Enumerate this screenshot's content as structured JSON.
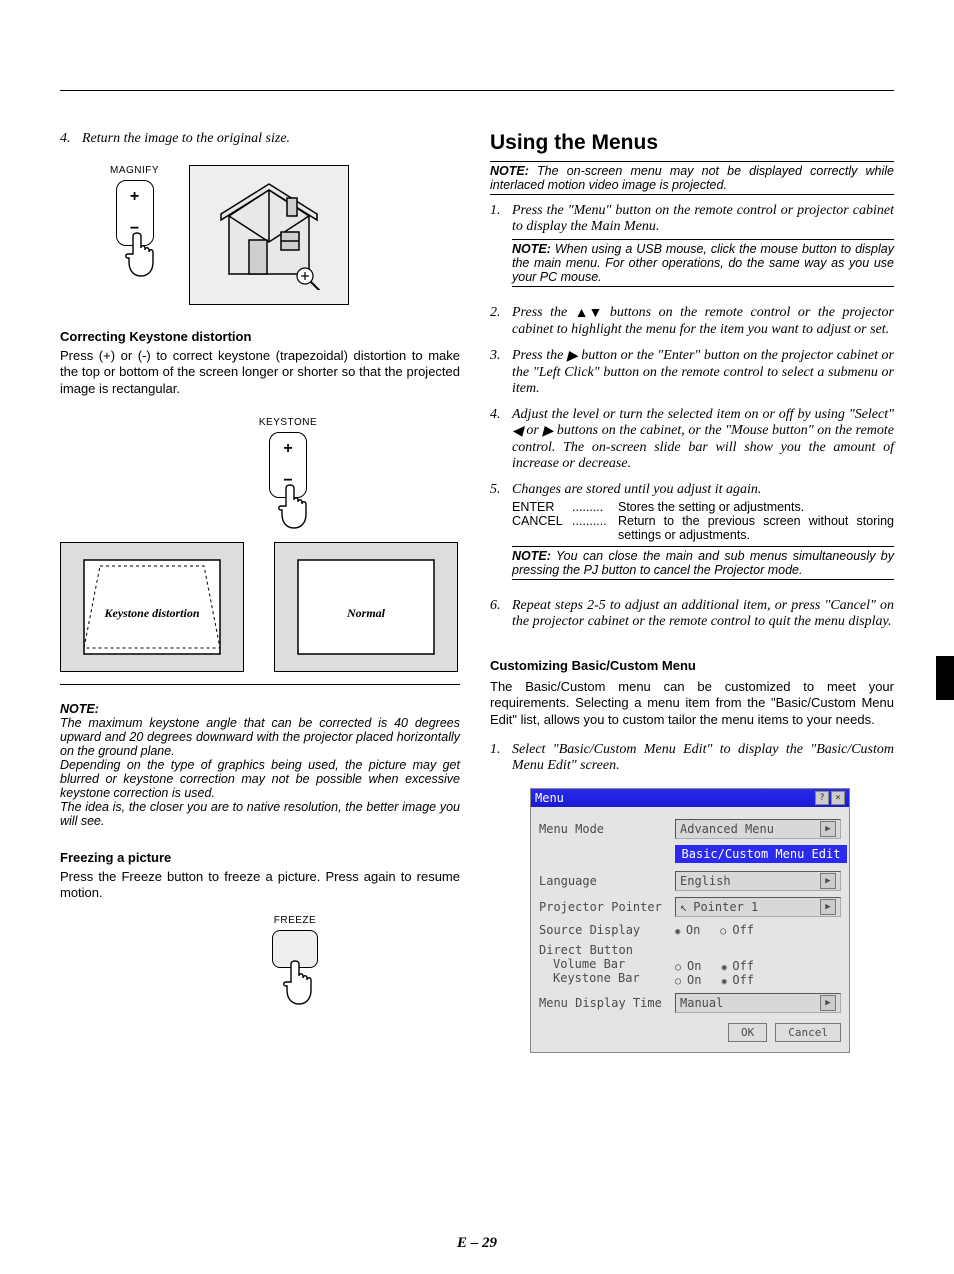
{
  "left": {
    "step4": "Return the image to the original size.",
    "magnify_label": "MAGNIFY",
    "keystone_h": "Correcting Keystone distortion",
    "keystone_body": "Press (+) or (-) to correct keystone (trapezoidal) distortion to make the top or bottom of the screen longer or shorter so that the projected image is rectangular.",
    "keystone_label": "KEYSTONE",
    "trap_distortion": "Keystone distortion",
    "trap_normal": "Normal",
    "keystone_note": "The maximum keystone angle that can be corrected is 40 degrees upward and 20 degrees downward with the projector placed horizontally on the ground plane.\nDepending on the type of graphics being used, the picture may get blurred or keystone correction may not be possible when excessive keystone correction is used.\nThe idea is, the closer you are to native resolution, the better image you will see.",
    "freeze_h": "Freezing a picture",
    "freeze_body": "Press the Freeze button to freeze a picture. Press again to resume motion.",
    "freeze_label": "FREEZE"
  },
  "right": {
    "h2": "Using the Menus",
    "note_top": "The on-screen menu may not be displayed correctly while interlaced motion video image is projected.",
    "s1": "Press the \"Menu\" button on the remote control or projector cabinet to display the Main Menu.",
    "s1_note": "When using a USB mouse, click the mouse button to display the main menu. For other operations, do the same way as you use your PC mouse.",
    "s2_a": "Press the ",
    "s2_b": " buttons on the remote control or the projector cabinet to highlight the menu for the item you want to adjust or set.",
    "s3_a": "Press the ",
    "s3_b": " button or the \"Enter\" button on the projector cabinet or the \"Left Click\" button on the remote control to select a submenu or item.",
    "s4_a": "Adjust the level or turn the selected item on or off by using \"Select\" ",
    "s4_b": " buttons on the cabinet, or the \"Mouse button\" on the remote control. The on-screen slide bar will show you the amount of increase or decrease.",
    "s5": "Changes are stored until you adjust it again.",
    "enter_label": "ENTER",
    "enter_desc": "Stores the setting or adjustments.",
    "cancel_label": "CANCEL",
    "cancel_desc": "Return to the previous screen without storing settings or adjustments.",
    "s5_note": "You can close the main and sub menus simultaneously by pressing the PJ button to cancel the Projector mode.",
    "s6": "Repeat steps 2-5 to adjust an additional item, or press \"Cancel\" on the projector cabinet or the remote control to quit the menu display.",
    "custom_h": "Customizing Basic/Custom Menu",
    "custom_body": "The Basic/Custom menu can be customized to meet your requirements. Selecting a menu item from the \"Basic/Custom Menu Edit\" list, allows you to custom tailor the menu items to your needs.",
    "custom_s1": "Select \"Basic/Custom Menu Edit\" to display the \"Basic/Custom Menu Edit\" screen."
  },
  "osd": {
    "title": "Menu",
    "mode_label": "Menu Mode",
    "mode_value": "Advanced Menu",
    "edit_bar": "Basic/Custom Menu Edit",
    "language_label": "Language",
    "language_value": "English",
    "pointer_label": "Projector Pointer",
    "pointer_value": "Pointer 1",
    "source_label": "Source Display",
    "direct_label": "Direct Button",
    "volume_label": "Volume Bar",
    "keystone_label": "Keystone Bar",
    "display_time_label": "Menu Display Time",
    "display_time_value": "Manual",
    "on": "On",
    "off": "Off",
    "ok": "OK",
    "cancel": "Cancel"
  },
  "footer": "E – 29",
  "note_prefix": "NOTE:"
}
